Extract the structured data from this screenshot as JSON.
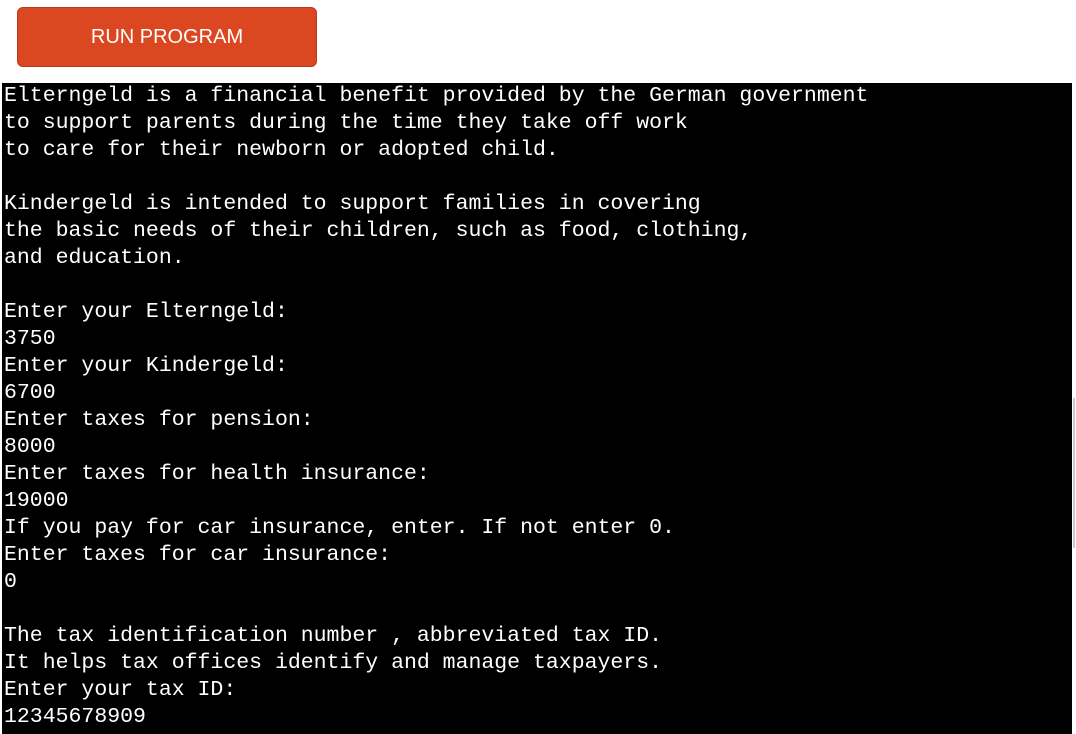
{
  "toolbar": {
    "run_label": "RUN PROGRAM"
  },
  "terminal": {
    "lines": [
      "Elterngeld is a financial benefit provided by the German government",
      "to support parents during the time they take off work",
      "to care for their newborn or adopted child.",
      "",
      "Kindergeld is intended to support families in covering",
      "the basic needs of their children, such as food, clothing,",
      "and education.",
      "",
      "Enter your Elterngeld:",
      "3750",
      "Enter your Kindergeld:",
      "6700",
      "Enter taxes for pension:",
      "8000",
      "Enter taxes for health insurance:",
      "19000",
      "If you pay for car insurance, enter. If not enter 0.",
      "Enter taxes for car insurance:",
      "0",
      "",
      "The tax identification number , abbreviated tax ID.",
      "It helps tax offices identify and manage taxpayers.",
      "Enter your tax ID:",
      "12345678909"
    ]
  },
  "colors": {
    "button_bg": "#db4720",
    "terminal_bg": "#000000",
    "terminal_fg": "#ffffff"
  }
}
